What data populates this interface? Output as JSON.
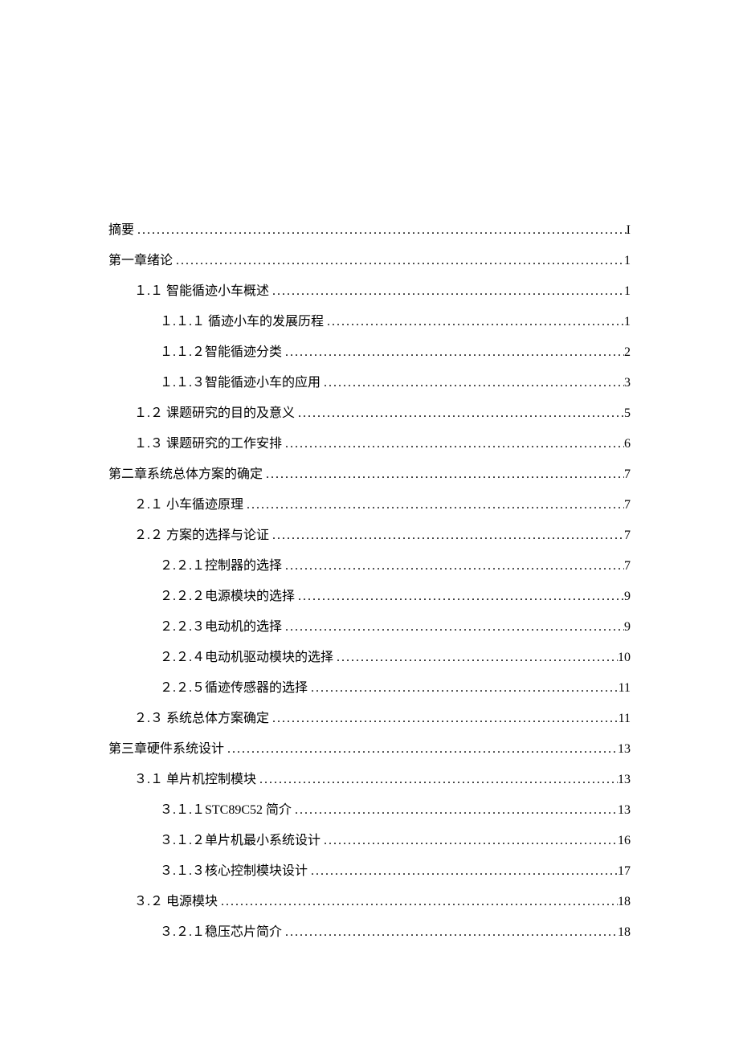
{
  "toc": [
    {
      "label": "摘要",
      "page": "I",
      "indent": 0
    },
    {
      "label": "第一章绪论",
      "page": "1",
      "indent": 0
    },
    {
      "label": "１.１ 智能循迹小车概述",
      "page": "1",
      "indent": 1
    },
    {
      "label": "１.１.１ 循迹小车的发展历程",
      "page": "1",
      "indent": 2
    },
    {
      "label": "１.１.２智能循迹分类",
      "page": "2",
      "indent": 2
    },
    {
      "label": "１.１.３智能循迹小车的应用",
      "page": "3",
      "indent": 2
    },
    {
      "label": "１.２ 课题研究的目的及意义",
      "page": "5",
      "indent": 1
    },
    {
      "label": "１.３ 课题研究的工作安排",
      "page": "6",
      "indent": 1
    },
    {
      "label": "第二章系统总体方案的确定",
      "page": "7",
      "indent": 0
    },
    {
      "label": "２.１ 小车循迹原理",
      "page": "7",
      "indent": 1
    },
    {
      "label": "２.２ 方案的选择与论证",
      "page": "7",
      "indent": 1
    },
    {
      "label": "２.２.１控制器的选择",
      "page": "7",
      "indent": 2
    },
    {
      "label": "２.２.２电源模块的选择",
      "page": "9",
      "indent": 2
    },
    {
      "label": "２.２.３电动机的选择",
      "page": "9",
      "indent": 2
    },
    {
      "label": "２.２.４电动机驱动模块的选择",
      "page": "10",
      "indent": 2
    },
    {
      "label": "２.２.５循迹传感器的选择",
      "page": "11",
      "indent": 2
    },
    {
      "label": "２.３ 系统总体方案确定",
      "page": "11",
      "indent": 1
    },
    {
      "label": "第三章硬件系统设计",
      "page": "13",
      "indent": 0
    },
    {
      "label": "３.１ 单片机控制模块",
      "page": "13",
      "indent": 1
    },
    {
      "label": "３.１.１STC89C52 简介",
      "page": "13",
      "indent": 2
    },
    {
      "label": "３.１.２单片机最小系统设计",
      "page": "16",
      "indent": 2
    },
    {
      "label": "３.１.３核心控制模块设计",
      "page": "17",
      "indent": 2
    },
    {
      "label": "３.２ 电源模块",
      "page": "18",
      "indent": 1
    },
    {
      "label": "３.２.１稳压芯片简介",
      "page": "18",
      "indent": 2
    }
  ]
}
